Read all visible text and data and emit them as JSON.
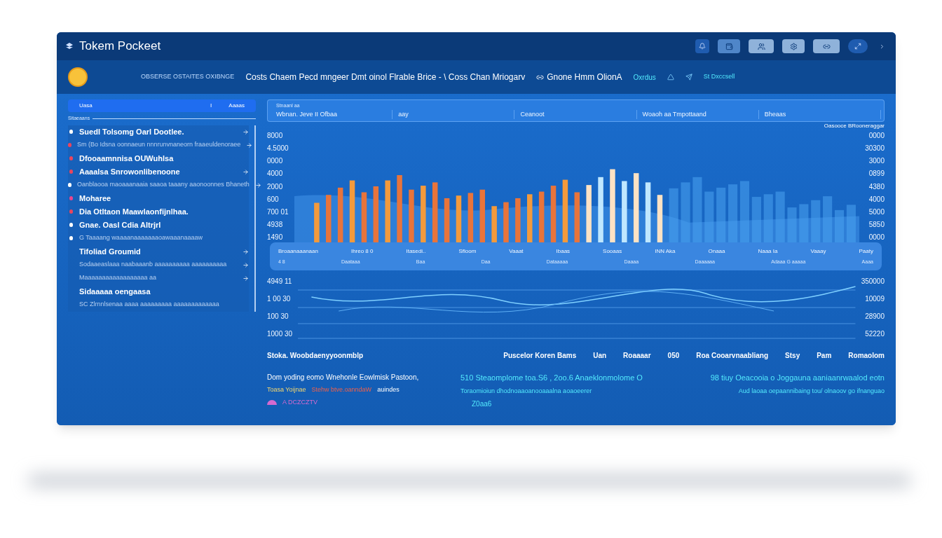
{
  "window": {
    "title": "Tokem Pockeet"
  },
  "nav": {
    "caption": "OBSERSE OSTAITES OXIBNGE",
    "headline": "Costs Chaem Pecd  mngeer Dmt oinol  Flrable Brice - \\ Coss Chan Mriogarv",
    "link": "Gnone  Hmm OlionA",
    "status": "Oxrdus",
    "account": "St Dxccsell"
  },
  "sidebar": {
    "header": {
      "label": "Uasa",
      "count": "I",
      "action": "Aaaas"
    },
    "subheader": "Sitaeaans",
    "items": [
      {
        "kind": "title",
        "text": "Suedl Tolsomg Oarl Dootlee.",
        "color": "#ffffff",
        "arrow": true
      },
      {
        "kind": "detail",
        "text": "Sm (Bo Idsna oonnaeun nnnrunvnaneorn fraaeuldenoraee",
        "color": "#e8455e",
        "arrow": true
      },
      {
        "kind": "title",
        "text": "Dfooaamnnisa OUWuhlsa",
        "color": "#e8455e",
        "arrow": false
      },
      {
        "kind": "title",
        "text": "Aaaalsa Snrowonlibenoone",
        "color": "#e8455e",
        "arrow": true
      },
      {
        "kind": "detail",
        "text": "Oanblaooa maoaaanaaia saaoa taaany aaonoonnes Bhaneth",
        "color": "#ffffff",
        "arrow": true
      },
      {
        "kind": "title",
        "text": "Moharee",
        "color": "#e8458e",
        "arrow": false
      },
      {
        "kind": "title",
        "text": "Dia Otltaon Maawlaonfijnlhaa.",
        "color": "#e8455e",
        "arrow": false
      },
      {
        "kind": "title",
        "text": "Gnae. Oasl Cdia Altrjrl",
        "color": "#ffffff",
        "arrow": false
      },
      {
        "kind": "detail",
        "text": "G Taaaang waaaanaaaaaaaoawaaanaaaaw",
        "color": "#ffffff",
        "arrow": false
      },
      {
        "kind": "title",
        "text": "Tifoliad Groumid",
        "arrow": true
      },
      {
        "kind": "detail",
        "text": "Sodaaeaslaaa naabaaanb aaaaaaaaaa aaaaaaaaaa",
        "arrow": true
      },
      {
        "kind": "detail",
        "text": "Maaaaaaaaaaaaaaaaaa aa",
        "arrow": true
      },
      {
        "kind": "title",
        "text": "Sidaaaaa  oengaasa",
        "arrow": false
      },
      {
        "kind": "detail",
        "text": "SC Zlrnnlsenaa aaaa aaaaaaaaa aaaaaaaaaaaaa",
        "arrow": false
      }
    ]
  },
  "filters": {
    "caption": "Stnaanl aa",
    "fields": [
      "Wbnan.  Jeve  II  Ofbaa",
      "aay",
      "Ceanoot",
      "Woaoh aa  Tmpottaand",
      "Bheaas"
    ]
  },
  "bar_chart": {
    "legend": "Oasooce BRooneraggar",
    "left_ticks": [
      "8000",
      "4.5000",
      "0000",
      "4000",
      "2000",
      "600",
      "700 01",
      "4938",
      "1490"
    ],
    "right_ticks": [
      "0000",
      "30300",
      "3000",
      "0899",
      "4380",
      "4000",
      "5000",
      "5850",
      "0000"
    ]
  },
  "legend_panel": {
    "row_1": [
      "Broaanaaanaan",
      "Ihreo  8 0",
      "Itasedi..",
      "Sfloom",
      "Vaaat",
      "Ibaas",
      "Sooaas",
      "INN  Aka",
      "Onaaa",
      "Naaa  Ia",
      "Vaaay",
      "Paaty"
    ],
    "row_2": [
      "4 8",
      "Daataaa",
      "Baa",
      "Daa",
      "Dataaaaa",
      "Daaaa",
      "Daaaaaa",
      "Adaaa G aaaaa",
      "Aaaa"
    ]
  },
  "wave_chart": {
    "left_ticks": [
      "4949 11",
      "1 00 30",
      "100 30",
      "1000 30"
    ],
    "right_ticks": [
      "350000",
      "10009",
      "28900",
      "52220"
    ]
  },
  "table": {
    "columns": [
      "Stoka. Woobdaenyyoonmblp",
      "Puscelor Koren Bams",
      "Uan",
      "Roaaaar",
      "050",
      "Roa Cooarvnaabliang",
      "Stsy",
      "Pam",
      "Romaolom"
    ]
  },
  "summary": {
    "left": {
      "line_1": "Dom yoding eomo Wnehonle Eowlmisk Pastoon,",
      "line_2": [
        {
          "text": "Toasa Yoijnae",
          "kind": "highlight"
        },
        {
          "text": "Stehw btve.oanndaW",
          "kind": "alert"
        },
        {
          "text": "auindes",
          "kind": "plain"
        }
      ],
      "tag": "A DCZCZTV"
    },
    "middle": {
      "line_1": "510  Steaomplome toa.S6 , 2oo.6 Anaeklonmolome O",
      "line_2": "Toraomioiun dhodnoaaoanooaaalna aoaoeerer",
      "note": "Z0aa6"
    },
    "right": {
      "line_1": "98 tiuy Oeacooia o Joggauna aaniaanrwaalod eotn",
      "line_2": "Aud laoaa oepaannibaing tou/  olnaoov  go ifnanguao"
    }
  }
}
